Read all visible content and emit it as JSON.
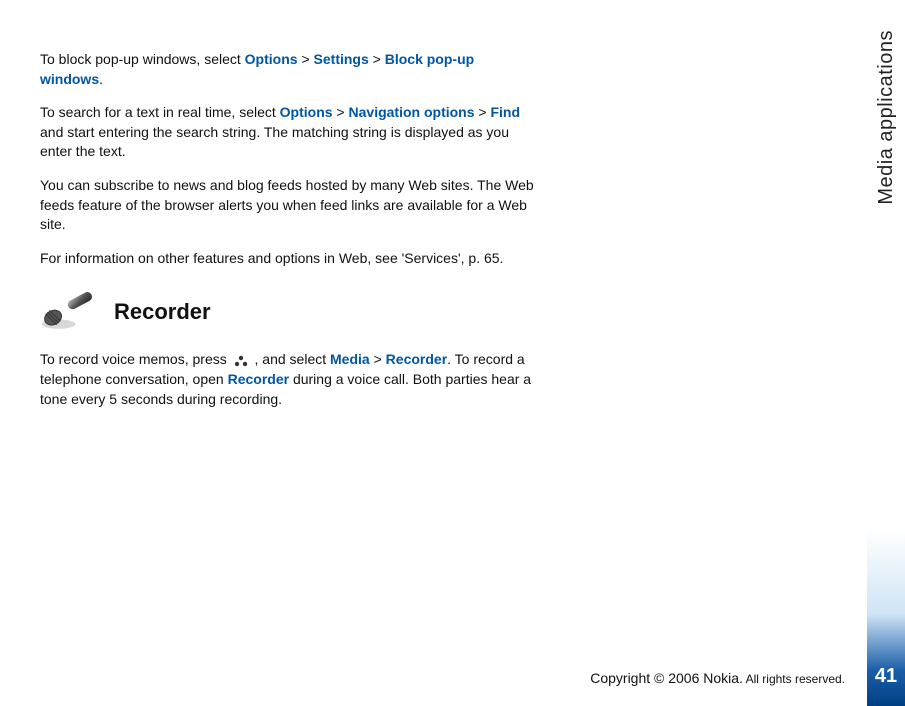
{
  "paragraphs": {
    "p1_a": "To block pop-up windows, select ",
    "p1_path": [
      "Options",
      "Settings",
      "Block pop-up windows"
    ],
    "p1_end": ".",
    "p2_a": "To search for a text in real time, select ",
    "p2_path": [
      "Options",
      "Navigation options",
      "Find"
    ],
    "p2_b": " and start entering the search string. The matching string is displayed as you enter the text.",
    "p3": "You can subscribe to news and blog feeds hosted by many Web sites. The Web feeds feature of the browser alerts you when feed links are available for a Web site.",
    "p4": "For information on other features and options in Web, see 'Services', p. 65."
  },
  "recorder": {
    "heading": "Recorder",
    "p1_a": "To record voice memos, press ",
    "p1_b": " , and select ",
    "p1_path": [
      "Media",
      "Recorder"
    ],
    "p1_c": ". To record a telephone conversation, open ",
    "p1_hl": "Recorder",
    "p1_d": " during a voice call. Both parties hear a tone every 5 seconds during recording."
  },
  "sideTab": "Media applications",
  "pageNumber": "41",
  "footer": {
    "copyright": "Copyright © 2006 Nokia.",
    "rights": " All rights reserved."
  },
  "sep": " > "
}
